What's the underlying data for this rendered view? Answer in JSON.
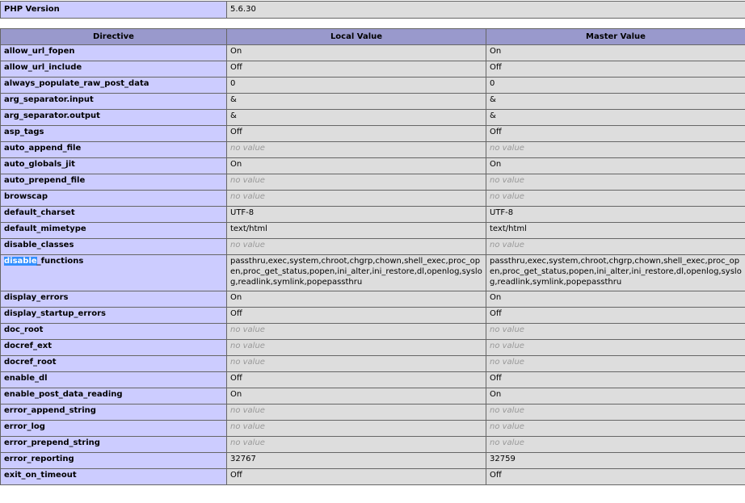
{
  "version_row": {
    "label": "PHP Version",
    "value": "5.6.30"
  },
  "columns": {
    "directive": "Directive",
    "local": "Local Value",
    "master": "Master Value"
  },
  "no_value_text": "no value",
  "highlight": {
    "row_index": 13,
    "selected_part": "disable",
    "rest": "_functions"
  },
  "rows": [
    {
      "name": "allow_url_fopen",
      "local": "On",
      "master": "On"
    },
    {
      "name": "allow_url_include",
      "local": "Off",
      "master": "Off"
    },
    {
      "name": "always_populate_raw_post_data",
      "local": "0",
      "master": "0"
    },
    {
      "name": "arg_separator.input",
      "local": "&",
      "master": "&"
    },
    {
      "name": "arg_separator.output",
      "local": "&",
      "master": "&"
    },
    {
      "name": "asp_tags",
      "local": "Off",
      "master": "Off"
    },
    {
      "name": "auto_append_file",
      "local": null,
      "master": null
    },
    {
      "name": "auto_globals_jit",
      "local": "On",
      "master": "On"
    },
    {
      "name": "auto_prepend_file",
      "local": null,
      "master": null
    },
    {
      "name": "browscap",
      "local": null,
      "master": null
    },
    {
      "name": "default_charset",
      "local": "UTF-8",
      "master": "UTF-8"
    },
    {
      "name": "default_mimetype",
      "local": "text/html",
      "master": "text/html"
    },
    {
      "name": "disable_classes",
      "local": null,
      "master": null
    },
    {
      "name": "disable_functions",
      "local": "passthru,exec,system,chroot,chgrp,chown,shell_exec,proc_open,proc_get_status,popen,ini_alter,ini_restore,dl,openlog,syslog,readlink,symlink,popepassthru",
      "master": "passthru,exec,system,chroot,chgrp,chown,shell_exec,proc_open,proc_get_status,popen,ini_alter,ini_restore,dl,openlog,syslog,readlink,symlink,popepassthru"
    },
    {
      "name": "display_errors",
      "local": "On",
      "master": "On"
    },
    {
      "name": "display_startup_errors",
      "local": "Off",
      "master": "Off"
    },
    {
      "name": "doc_root",
      "local": null,
      "master": null
    },
    {
      "name": "docref_ext",
      "local": null,
      "master": null
    },
    {
      "name": "docref_root",
      "local": null,
      "master": null
    },
    {
      "name": "enable_dl",
      "local": "Off",
      "master": "Off"
    },
    {
      "name": "enable_post_data_reading",
      "local": "On",
      "master": "On"
    },
    {
      "name": "error_append_string",
      "local": null,
      "master": null
    },
    {
      "name": "error_log",
      "local": null,
      "master": null
    },
    {
      "name": "error_prepend_string",
      "local": null,
      "master": null
    },
    {
      "name": "error_reporting",
      "local": "32767",
      "master": "32759"
    },
    {
      "name": "exit_on_timeout",
      "local": "Off",
      "master": "Off"
    }
  ]
}
